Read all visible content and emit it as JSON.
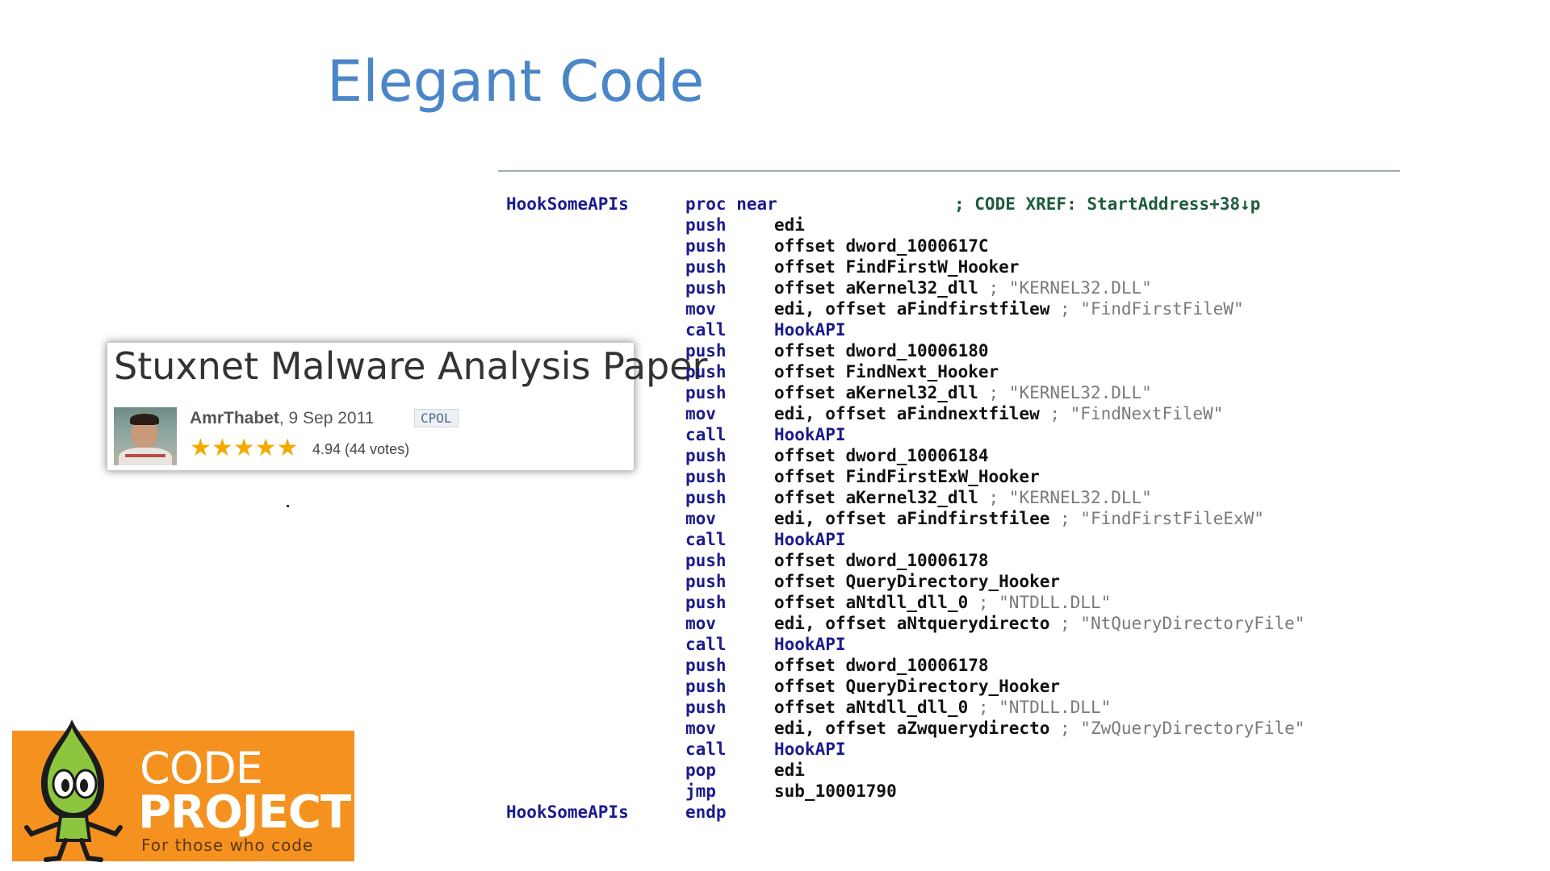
{
  "slide": {
    "title": "Elegant Code"
  },
  "article": {
    "title": "Stuxnet Malware Analysis Paper",
    "author": "AmrThabet",
    "date": ", 9 Sep 2011",
    "license": "CPOL",
    "stars": "★★★★★",
    "rating": "4.94 (44 votes)",
    "rating_value": 4.94,
    "rating_max": 5
  },
  "code": {
    "lines": [
      {
        "label": "HookSomeAPIs",
        "op": "proc near",
        "arg": "",
        "comment": "",
        "xref": "; CODE XREF: StartAddress+38↓p"
      },
      {
        "label": "",
        "op": "push",
        "arg": "edi",
        "comment": "",
        "xref": ""
      },
      {
        "label": "",
        "op": "push",
        "arg": "offset dword_1000617C",
        "comment": "",
        "xref": ""
      },
      {
        "label": "",
        "op": "push",
        "arg": "offset FindFirstW_Hooker",
        "comment": "",
        "xref": ""
      },
      {
        "label": "",
        "op": "push",
        "arg": "offset aKernel32_dll ",
        "comment": "; \"KERNEL32.DLL\"",
        "xref": ""
      },
      {
        "label": "",
        "op": "mov",
        "arg": "edi, offset aFindfirstfilew ",
        "comment": "; \"FindFirstFileW\"",
        "xref": ""
      },
      {
        "label": "",
        "op": "call",
        "arg": "HookAPI",
        "comment": "",
        "xref": "",
        "callref": true
      },
      {
        "label": "",
        "op": "push",
        "arg": "offset dword_10006180",
        "comment": "",
        "xref": ""
      },
      {
        "label": "",
        "op": "push",
        "arg": "offset FindNext_Hooker",
        "comment": "",
        "xref": ""
      },
      {
        "label": "",
        "op": "push",
        "arg": "offset aKernel32_dll ",
        "comment": "; \"KERNEL32.DLL\"",
        "xref": ""
      },
      {
        "label": "",
        "op": "mov",
        "arg": "edi, offset aFindnextfilew ",
        "comment": "; \"FindNextFileW\"",
        "xref": ""
      },
      {
        "label": "",
        "op": "call",
        "arg": "HookAPI",
        "comment": "",
        "xref": "",
        "callref": true
      },
      {
        "label": "",
        "op": "push",
        "arg": "offset dword_10006184",
        "comment": "",
        "xref": ""
      },
      {
        "label": "",
        "op": "push",
        "arg": "offset FindFirstExW_Hooker",
        "comment": "",
        "xref": ""
      },
      {
        "label": "",
        "op": "push",
        "arg": "offset aKernel32_dll ",
        "comment": "; \"KERNEL32.DLL\"",
        "xref": ""
      },
      {
        "label": "",
        "op": "mov",
        "arg": "edi, offset aFindfirstfilee ",
        "comment": "; \"FindFirstFileExW\"",
        "xref": ""
      },
      {
        "label": "",
        "op": "call",
        "arg": "HookAPI",
        "comment": "",
        "xref": "",
        "callref": true
      },
      {
        "label": "",
        "op": "push",
        "arg": "offset dword_10006178",
        "comment": "",
        "xref": ""
      },
      {
        "label": "",
        "op": "push",
        "arg": "offset QueryDirectory_Hooker",
        "comment": "",
        "xref": ""
      },
      {
        "label": "",
        "op": "push",
        "arg": "offset aNtdll_dll_0 ",
        "comment": "; \"NTDLL.DLL\"",
        "xref": ""
      },
      {
        "label": "",
        "op": "mov",
        "arg": "edi, offset aNtquerydirecto ",
        "comment": "; \"NtQueryDirectoryFile\"",
        "xref": ""
      },
      {
        "label": "",
        "op": "call",
        "arg": "HookAPI",
        "comment": "",
        "xref": "",
        "callref": true
      },
      {
        "label": "",
        "op": "push",
        "arg": "offset dword_10006178",
        "comment": "",
        "xref": ""
      },
      {
        "label": "",
        "op": "push",
        "arg": "offset QueryDirectory_Hooker",
        "comment": "",
        "xref": ""
      },
      {
        "label": "",
        "op": "push",
        "arg": "offset aNtdll_dll_0 ",
        "comment": "; \"NTDLL.DLL\"",
        "xref": ""
      },
      {
        "label": "",
        "op": "mov",
        "arg": "edi, offset aZwquerydirecto ",
        "comment": "; \"ZwQueryDirectoryFile\"",
        "xref": ""
      },
      {
        "label": "",
        "op": "call",
        "arg": "HookAPI",
        "comment": "",
        "xref": "",
        "callref": true
      },
      {
        "label": "",
        "op": "pop",
        "arg": "edi",
        "comment": "",
        "xref": ""
      },
      {
        "label": "",
        "op": "jmp",
        "arg": "sub_10001790",
        "comment": "",
        "xref": ""
      },
      {
        "label": "HookSomeAPIs",
        "op": "endp",
        "arg": "",
        "comment": "",
        "xref": ""
      }
    ]
  },
  "logo": {
    "line1": "CODE",
    "line2": "PROJECT",
    "tagline": "For those who code",
    "color": "#f5911f"
  }
}
